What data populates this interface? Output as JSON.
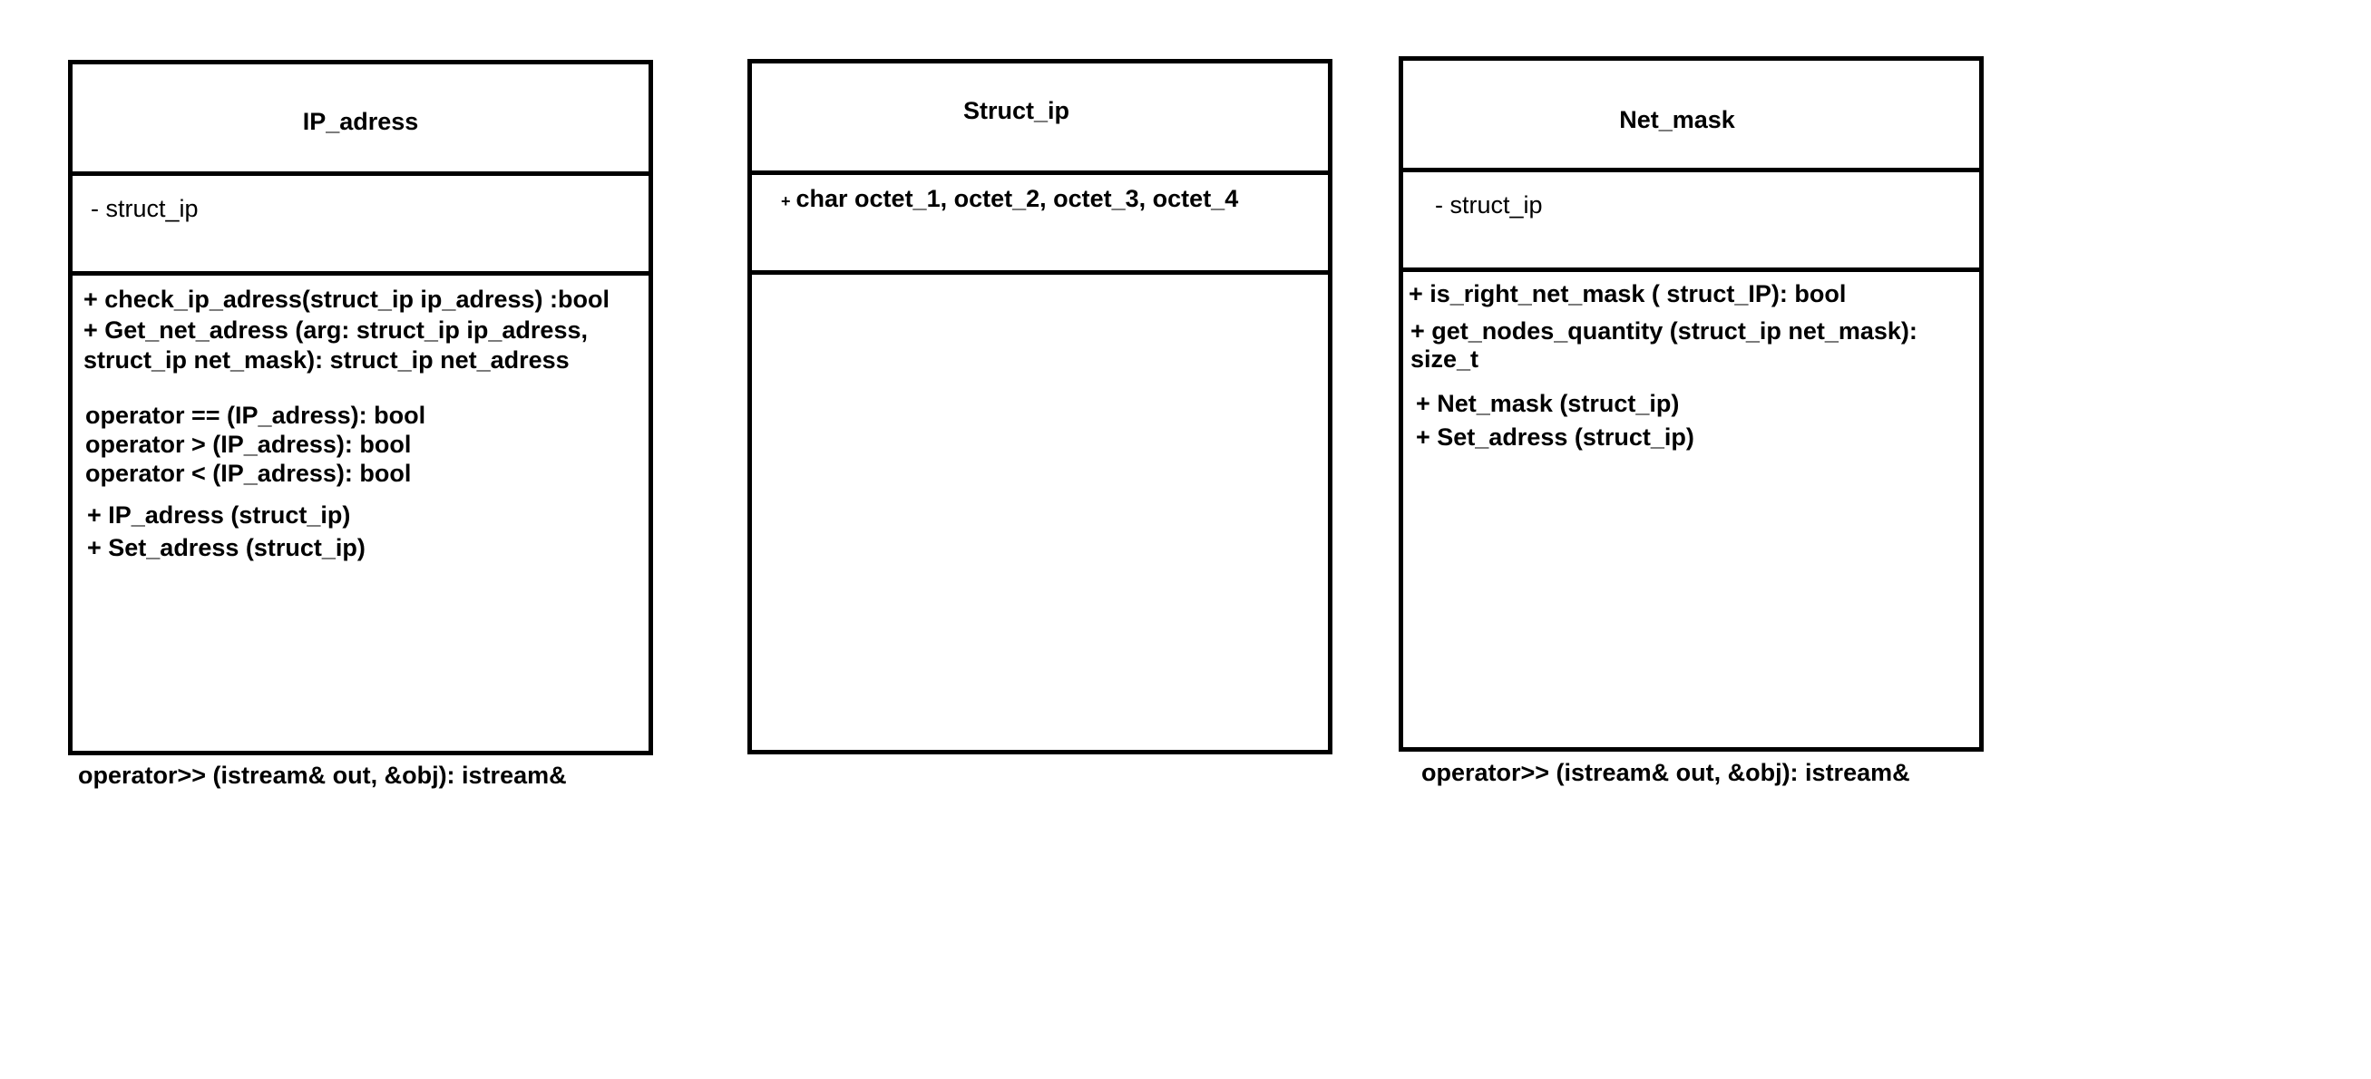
{
  "ip_adress": {
    "title": "IP_adress",
    "attribute": "- struct_ip",
    "methods": [
      "+ check_ip_adress(struct_ip ip_adress) :bool",
      "+ Get_net_adress (arg: struct_ip ip_adress,",
      "struct_ip net_mask): struct_ip net_adress",
      "operator == (IP_adress): bool",
      "operator > (IP_adress): bool",
      "operator < (IP_adress): bool",
      "+ IP_adress (struct_ip)",
      "+ Set_adress (struct_ip)"
    ],
    "footer": "operator>> (istream& out, &obj): istream&"
  },
  "struct_ip": {
    "title": "Struct_ip",
    "attribute_marker": "+",
    "attribute": "char octet_1, octet_2, octet_3, octet_4"
  },
  "net_mask": {
    "title": "Net_mask",
    "attribute": "- struct_ip",
    "methods": [
      "+ is_right_net_mask ( struct_IP): bool",
      "+ get_nodes_quantity (struct_ip net_mask):",
      "size_t",
      "+ Net_mask (struct_ip)",
      "+ Set_adress (struct_ip)"
    ],
    "footer": "operator>> (istream& out, &obj): istream&"
  }
}
